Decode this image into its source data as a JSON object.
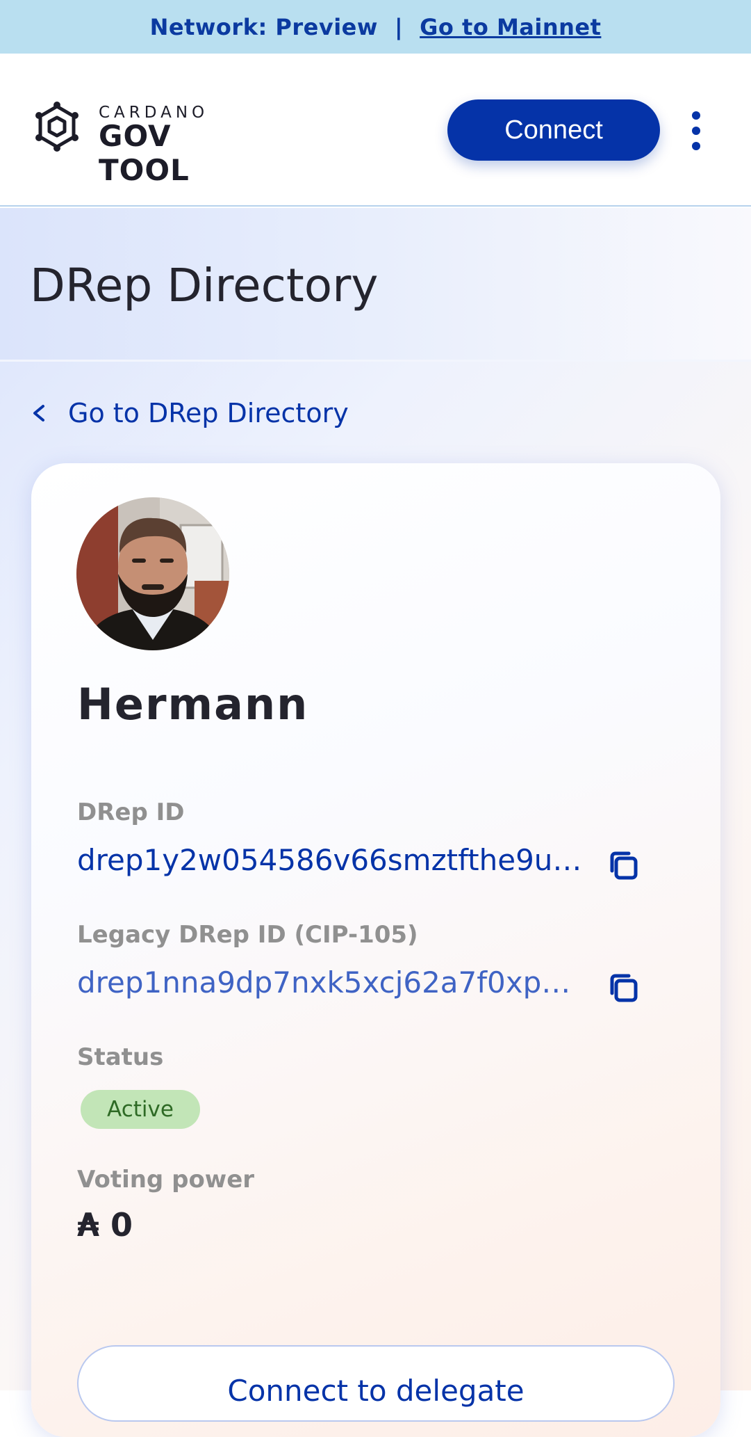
{
  "network_bar": {
    "network_text": "Network: Preview",
    "separator": "|",
    "mainnet_link": "Go to Mainnet"
  },
  "header": {
    "logo_small": "CARDANO",
    "logo_big": "GOV TOOL",
    "connect_label": "Connect"
  },
  "page": {
    "title": "DRep Directory",
    "back_link": "Go to DRep Directory"
  },
  "drep": {
    "name": "Hermann",
    "id_label": "DRep ID",
    "id_value": "drep1y2w054586v66smztfthe9u…",
    "legacy_id_label": "Legacy DRep ID (CIP-105)",
    "legacy_id_value": "drep1nna9dp7nxk5xcj62a7f0xp…",
    "status_label": "Status",
    "status_value": "Active",
    "voting_power_label": "Voting power",
    "voting_power_value": "₳ 0",
    "delegate_button": "Connect to delegate"
  },
  "colors": {
    "brand": "#0533a8",
    "network_bar": "#b9dff0",
    "status_active_bg": "#c2e5b7",
    "status_active_text": "#2e6a25"
  }
}
